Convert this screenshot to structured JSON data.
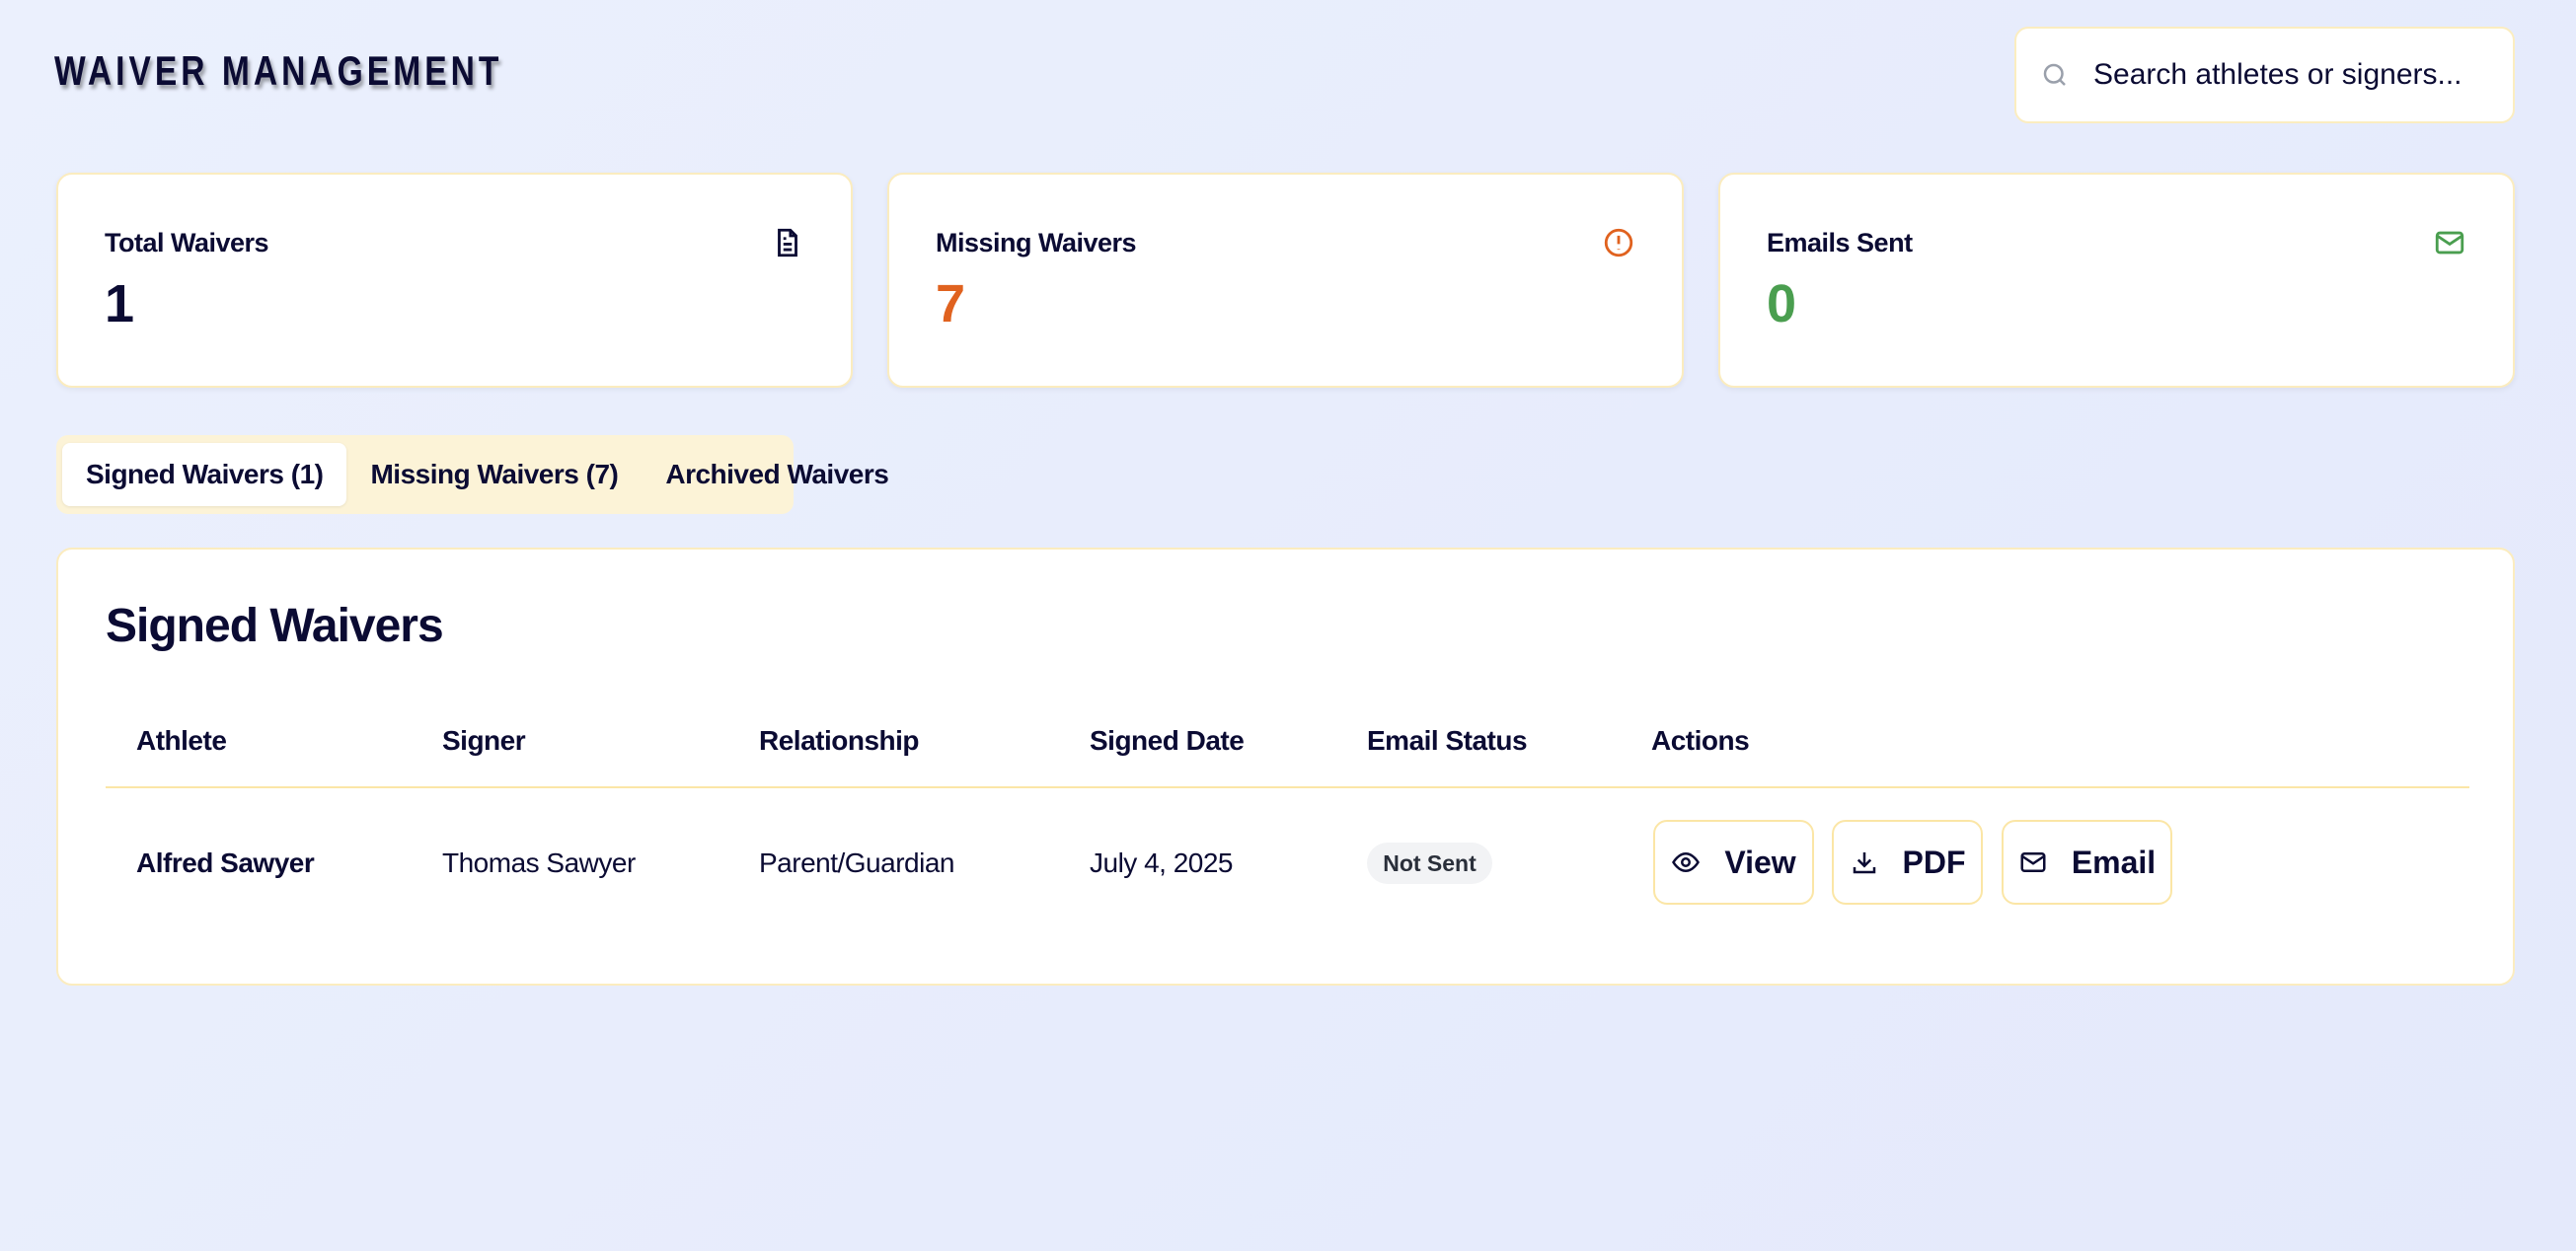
{
  "header": {
    "title": "WAIVER MANAGEMENT",
    "search_placeholder": "Search athletes or signers...",
    "search_value": ""
  },
  "stats": [
    {
      "label": "Total Waivers",
      "value": "1",
      "icon": "document-icon",
      "color": "#0b0b33"
    },
    {
      "label": "Missing Waivers",
      "value": "7",
      "icon": "alert-circle-icon",
      "color": "#e0621f"
    },
    {
      "label": "Emails Sent",
      "value": "0",
      "icon": "mail-icon",
      "color": "#4a9e4f"
    }
  ],
  "tabs": [
    {
      "label": "Signed Waivers (1)",
      "active": true
    },
    {
      "label": "Missing Waivers (7)"
    },
    {
      "label": "Archived Waivers"
    }
  ],
  "panel": {
    "title": "Signed Waivers",
    "columns": [
      "Athlete",
      "Signer",
      "Relationship",
      "Signed Date",
      "Email Status",
      "Actions"
    ],
    "rows": [
      {
        "athlete": "Alfred Sawyer",
        "signer": "Thomas Sawyer",
        "relationship": "Parent/Guardian",
        "signed_date": "July 4, 2025",
        "email_status": "Not Sent",
        "actions": [
          "View",
          "PDF",
          "Email"
        ]
      }
    ]
  }
}
